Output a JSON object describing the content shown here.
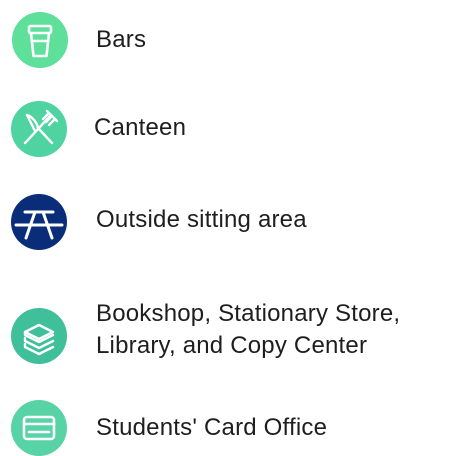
{
  "legend": {
    "items": [
      {
        "label": "Bars",
        "icon": "cup-icon",
        "color": "#5ee09a"
      },
      {
        "label": "Canteen",
        "icon": "fork-knife-icon",
        "color": "#4fd3a0"
      },
      {
        "label": "Outside sitting area",
        "icon": "picnic-table-icon",
        "color": "#0a2d7a"
      },
      {
        "label_lines": [
          "Bookshop, Stationary Store,",
          "Library, and Copy Center"
        ],
        "icon": "books-icon",
        "color": "#3fbf9a"
      },
      {
        "label": "Students' Card Office",
        "icon": "card-icon",
        "color": "#57d3a6"
      }
    ]
  }
}
